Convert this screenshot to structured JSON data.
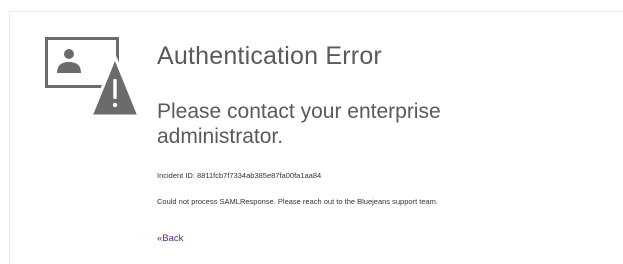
{
  "error_page": {
    "icon": "user-screen-warning-icon",
    "title": "Authentication Error",
    "subtitle": "Please contact your enterprise administrator.",
    "incident_label": "Incident ID:",
    "incident_id": "8811fcb7f7334ab385e87fa00fa1aa84",
    "message": "Could not process SAMLResponse. Please reach out to the Bluejeans support team.",
    "back_link": "«Back"
  },
  "colors": {
    "icon_gray": "#6b6b6b",
    "heading_text": "#5a5a5a",
    "body_text": "#333333",
    "link": "#5b2a86"
  }
}
